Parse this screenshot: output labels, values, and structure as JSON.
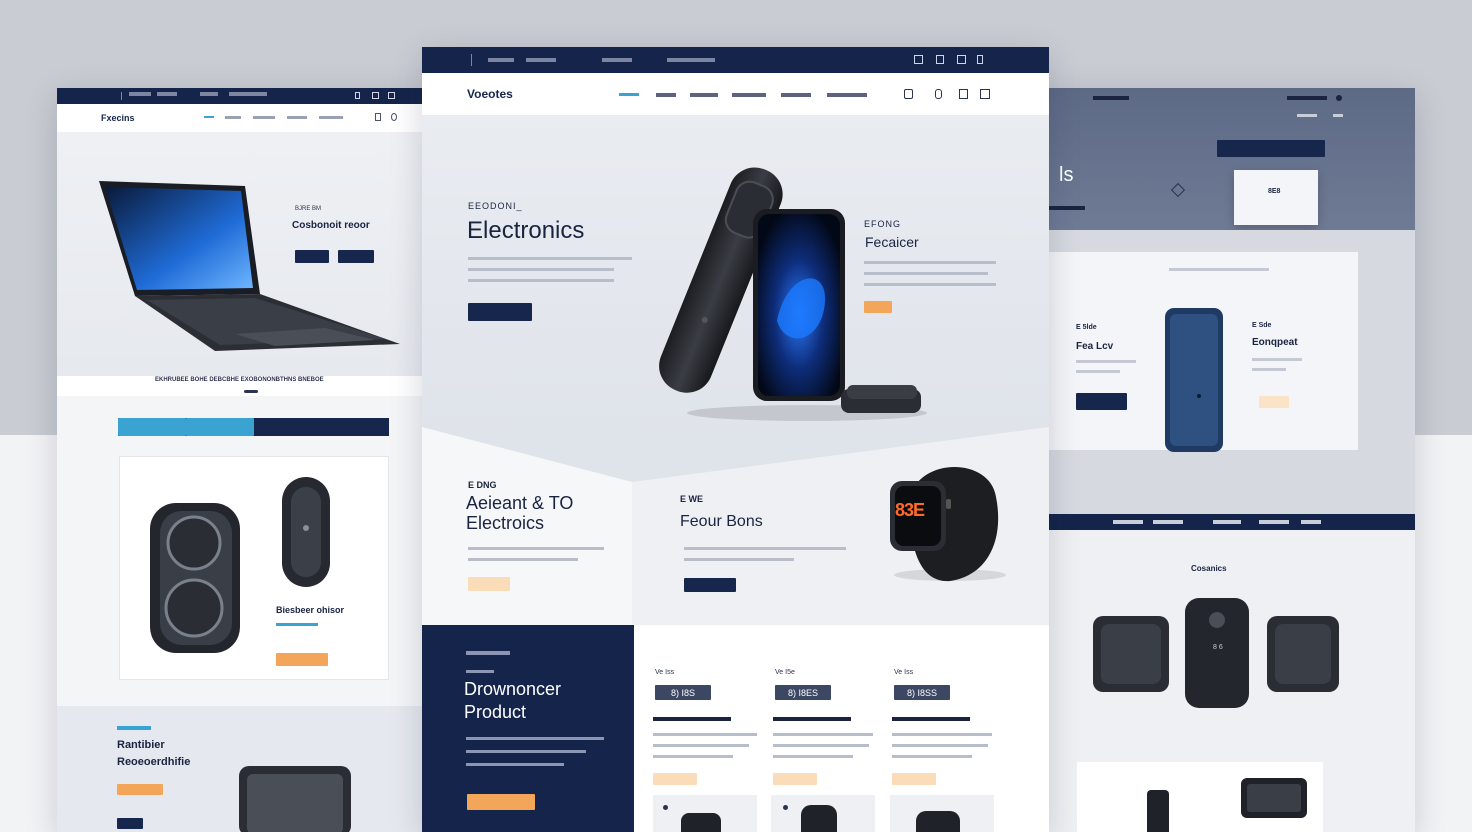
{
  "left": {
    "topbar": [
      "",
      "",
      "",
      ""
    ],
    "brand": "Fxecins",
    "hero_eyebrow": "BJRE BM",
    "hero_title": "Cosbonoit reoor",
    "hero_btn1": "",
    "hero_btn2": "",
    "strip_text": "EKHRUBEE BOHE DEBCBHE EXOBONONBTHNS BNEBOE",
    "tabs": [
      "",
      "",
      "",
      ""
    ],
    "speaker_title": "Biesbeer ohisor",
    "speaker_btn": "",
    "bottom_eyebrow": "",
    "bottom_title1": "Rantibier",
    "bottom_title2": "Reoeoerdhifie",
    "bottom_btn1": "",
    "bottom_btn2": ""
  },
  "center": {
    "topbar": [
      "",
      "",
      "",
      ""
    ],
    "brand": "Voeotes",
    "nav": [
      "",
      "",
      "",
      ""
    ],
    "hero_eyebrow": "EEODONI_",
    "hero_title": "Electronics",
    "hero_btn": "",
    "side_eyebrow": "EFONG",
    "side_title": "Fecaicer",
    "side_btn": "",
    "promo1_eyebrow": "E DNG",
    "promo1_title1": "Aeieant & TO",
    "promo1_title2": "Electroics",
    "promo1_btn": "",
    "promo2_eyebrow": "E WE",
    "promo2_title": "Feour Bons",
    "promo2_btn": "",
    "watch_text": "83E",
    "feature_eyebrow": "",
    "feature_title1": "Drownoncer",
    "feature_title2": "Product",
    "feature_btn": "",
    "cards": [
      {
        "tag": "Ve Iss",
        "badge": "8) I8S",
        "name": "",
        "btn": ""
      },
      {
        "tag": "Ve I5e",
        "badge": "8) I8ES",
        "name": "",
        "btn": ""
      },
      {
        "tag": "Ve Iss",
        "badge": "8) I8SS",
        "name": "",
        "btn": ""
      }
    ]
  },
  "right": {
    "top_title": "ls",
    "top_label": "",
    "top_btn": "",
    "box_text": "8E8",
    "card1_eyebrow": "E 5lde",
    "card1_title": "Fea Lcv",
    "card1_btn": "",
    "card2_eyebrow": "E Sde",
    "card2_title": "Eonqpeat",
    "card2_btn": "",
    "navbar": [
      "",
      "",
      "",
      "",
      ""
    ],
    "section_title": "Cosanics",
    "speaker_label": "8 6"
  },
  "colors": {
    "navy": "#15244a",
    "orange": "#f3a65a",
    "teal": "#3aa3d1"
  }
}
